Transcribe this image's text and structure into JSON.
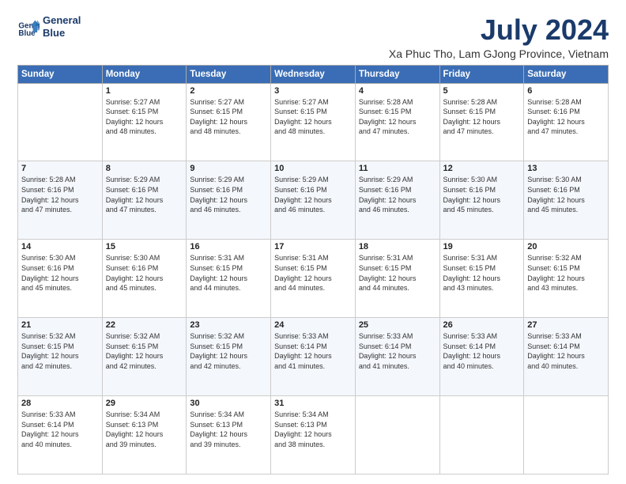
{
  "logo": {
    "line1": "General",
    "line2": "Blue"
  },
  "title": "July 2024",
  "location": "Xa Phuc Tho, Lam GJong Province, Vietnam",
  "days_of_week": [
    "Sunday",
    "Monday",
    "Tuesday",
    "Wednesday",
    "Thursday",
    "Friday",
    "Saturday"
  ],
  "weeks": [
    [
      {
        "num": "",
        "info": ""
      },
      {
        "num": "1",
        "info": "Sunrise: 5:27 AM\nSunset: 6:15 PM\nDaylight: 12 hours\nand 48 minutes."
      },
      {
        "num": "2",
        "info": "Sunrise: 5:27 AM\nSunset: 6:15 PM\nDaylight: 12 hours\nand 48 minutes."
      },
      {
        "num": "3",
        "info": "Sunrise: 5:27 AM\nSunset: 6:15 PM\nDaylight: 12 hours\nand 48 minutes."
      },
      {
        "num": "4",
        "info": "Sunrise: 5:28 AM\nSunset: 6:15 PM\nDaylight: 12 hours\nand 47 minutes."
      },
      {
        "num": "5",
        "info": "Sunrise: 5:28 AM\nSunset: 6:15 PM\nDaylight: 12 hours\nand 47 minutes."
      },
      {
        "num": "6",
        "info": "Sunrise: 5:28 AM\nSunset: 6:16 PM\nDaylight: 12 hours\nand 47 minutes."
      }
    ],
    [
      {
        "num": "7",
        "info": "Sunrise: 5:28 AM\nSunset: 6:16 PM\nDaylight: 12 hours\nand 47 minutes."
      },
      {
        "num": "8",
        "info": "Sunrise: 5:29 AM\nSunset: 6:16 PM\nDaylight: 12 hours\nand 47 minutes."
      },
      {
        "num": "9",
        "info": "Sunrise: 5:29 AM\nSunset: 6:16 PM\nDaylight: 12 hours\nand 46 minutes."
      },
      {
        "num": "10",
        "info": "Sunrise: 5:29 AM\nSunset: 6:16 PM\nDaylight: 12 hours\nand 46 minutes."
      },
      {
        "num": "11",
        "info": "Sunrise: 5:29 AM\nSunset: 6:16 PM\nDaylight: 12 hours\nand 46 minutes."
      },
      {
        "num": "12",
        "info": "Sunrise: 5:30 AM\nSunset: 6:16 PM\nDaylight: 12 hours\nand 45 minutes."
      },
      {
        "num": "13",
        "info": "Sunrise: 5:30 AM\nSunset: 6:16 PM\nDaylight: 12 hours\nand 45 minutes."
      }
    ],
    [
      {
        "num": "14",
        "info": "Sunrise: 5:30 AM\nSunset: 6:16 PM\nDaylight: 12 hours\nand 45 minutes."
      },
      {
        "num": "15",
        "info": "Sunrise: 5:30 AM\nSunset: 6:16 PM\nDaylight: 12 hours\nand 45 minutes."
      },
      {
        "num": "16",
        "info": "Sunrise: 5:31 AM\nSunset: 6:15 PM\nDaylight: 12 hours\nand 44 minutes."
      },
      {
        "num": "17",
        "info": "Sunrise: 5:31 AM\nSunset: 6:15 PM\nDaylight: 12 hours\nand 44 minutes."
      },
      {
        "num": "18",
        "info": "Sunrise: 5:31 AM\nSunset: 6:15 PM\nDaylight: 12 hours\nand 44 minutes."
      },
      {
        "num": "19",
        "info": "Sunrise: 5:31 AM\nSunset: 6:15 PM\nDaylight: 12 hours\nand 43 minutes."
      },
      {
        "num": "20",
        "info": "Sunrise: 5:32 AM\nSunset: 6:15 PM\nDaylight: 12 hours\nand 43 minutes."
      }
    ],
    [
      {
        "num": "21",
        "info": "Sunrise: 5:32 AM\nSunset: 6:15 PM\nDaylight: 12 hours\nand 42 minutes."
      },
      {
        "num": "22",
        "info": "Sunrise: 5:32 AM\nSunset: 6:15 PM\nDaylight: 12 hours\nand 42 minutes."
      },
      {
        "num": "23",
        "info": "Sunrise: 5:32 AM\nSunset: 6:15 PM\nDaylight: 12 hours\nand 42 minutes."
      },
      {
        "num": "24",
        "info": "Sunrise: 5:33 AM\nSunset: 6:14 PM\nDaylight: 12 hours\nand 41 minutes."
      },
      {
        "num": "25",
        "info": "Sunrise: 5:33 AM\nSunset: 6:14 PM\nDaylight: 12 hours\nand 41 minutes."
      },
      {
        "num": "26",
        "info": "Sunrise: 5:33 AM\nSunset: 6:14 PM\nDaylight: 12 hours\nand 40 minutes."
      },
      {
        "num": "27",
        "info": "Sunrise: 5:33 AM\nSunset: 6:14 PM\nDaylight: 12 hours\nand 40 minutes."
      }
    ],
    [
      {
        "num": "28",
        "info": "Sunrise: 5:33 AM\nSunset: 6:14 PM\nDaylight: 12 hours\nand 40 minutes."
      },
      {
        "num": "29",
        "info": "Sunrise: 5:34 AM\nSunset: 6:13 PM\nDaylight: 12 hours\nand 39 minutes."
      },
      {
        "num": "30",
        "info": "Sunrise: 5:34 AM\nSunset: 6:13 PM\nDaylight: 12 hours\nand 39 minutes."
      },
      {
        "num": "31",
        "info": "Sunrise: 5:34 AM\nSunset: 6:13 PM\nDaylight: 12 hours\nand 38 minutes."
      },
      {
        "num": "",
        "info": ""
      },
      {
        "num": "",
        "info": ""
      },
      {
        "num": "",
        "info": ""
      }
    ]
  ]
}
